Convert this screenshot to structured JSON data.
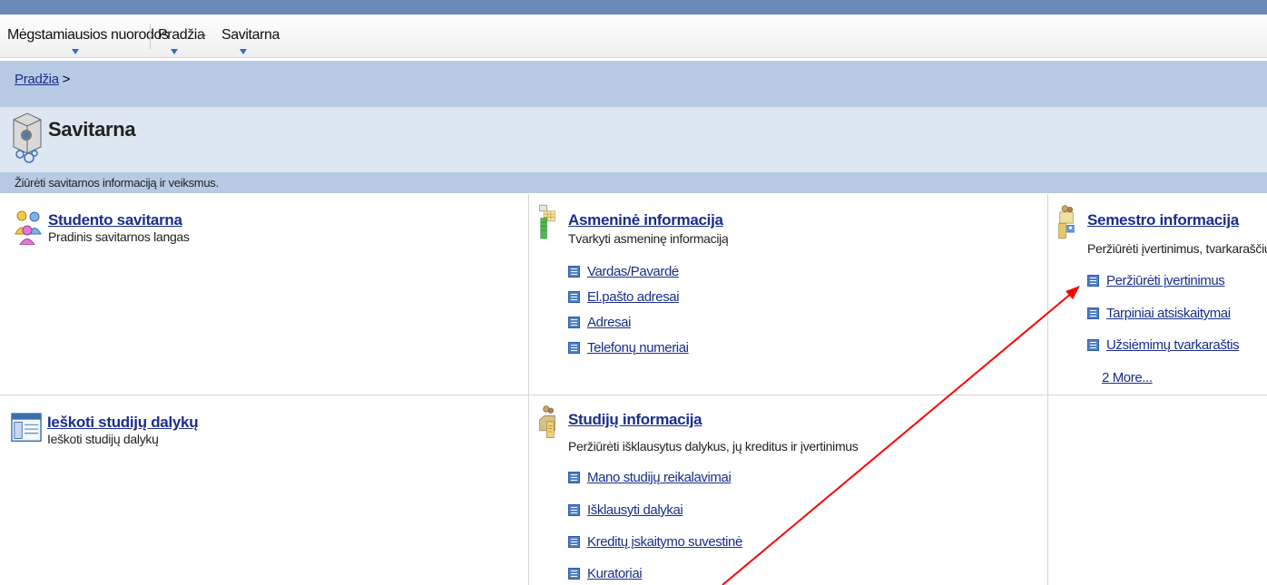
{
  "nav": {
    "favorites": "Mėgstamiausios nuorodos",
    "home": "Pradžia",
    "chevron": "›",
    "self_service": "Savitarna"
  },
  "breadcrumb": {
    "home_link": "Pradžia",
    "separator": " >"
  },
  "page": {
    "title": "Savitarna",
    "description": "Žiūrėti savitarnos informaciją ir veiksmus."
  },
  "tiles": {
    "student": {
      "title": "Studento savitarna",
      "desc": "Pradinis savitarnos langas",
      "icon": "people-icon"
    },
    "personal": {
      "title": "Asmeninė informacija",
      "desc": "Tvarkyti asmeninę informaciją",
      "icon": "personal-info-icon",
      "links": [
        "Vardas/Pavardė",
        "El.pašto adresai",
        "Adresai",
        "Telefonų numeriai"
      ]
    },
    "semester": {
      "title": "Semestro informacija",
      "desc": "Peržiūrėti įvertinimus, tvarkaraščius,",
      "icon": "semester-info-icon",
      "links": [
        "Peržiūrėti įvertinimus",
        "Tarpiniai atsiskaitymai",
        "Užsiėmimų tvarkaraštis"
      ],
      "more": "2 More..."
    },
    "search": {
      "title": "Ieškoti studijų dalykų",
      "desc": "Ieškoti studijų dalykų",
      "icon": "search-courses-icon"
    },
    "studies": {
      "title": "Studijų informacija",
      "desc": "Peržiūrėti išklausytus dalykus, jų kreditus ir įvertinimus",
      "icon": "studies-info-icon",
      "links": [
        "Mano studijų reikalavimai",
        "Išklausyti dalykai",
        "Kreditų įskaitymo suvestinė",
        "Kuratoriai"
      ]
    }
  },
  "colors": {
    "link": "#1a2e8a",
    "band": "#b6cbe3",
    "title_band": "#dce7f2",
    "top_strip": "#6a89b4",
    "annotation_arrow": "#ff0000"
  }
}
